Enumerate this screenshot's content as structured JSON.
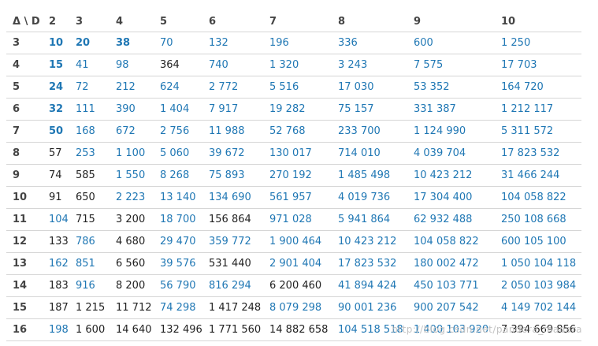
{
  "table": {
    "columns": [
      "Δ \\ D",
      "2",
      "3",
      "4",
      "5",
      "6",
      "7",
      "8",
      "9",
      "10"
    ],
    "rows": [
      {
        "label": "3",
        "cells": [
          {
            "v": "10",
            "s": "lb"
          },
          {
            "v": "20",
            "s": "lb"
          },
          {
            "v": "38",
            "s": "lb"
          },
          {
            "v": "70",
            "s": "l"
          },
          {
            "v": "132",
            "s": "l"
          },
          {
            "v": "196",
            "s": "l"
          },
          {
            "v": "336",
            "s": "l"
          },
          {
            "v": "600",
            "s": "l"
          },
          {
            "v": "1 250",
            "s": "l"
          }
        ]
      },
      {
        "label": "4",
        "cells": [
          {
            "v": "15",
            "s": "lb"
          },
          {
            "v": "41",
            "s": "l"
          },
          {
            "v": "98",
            "s": "l"
          },
          {
            "v": "364",
            "s": "p"
          },
          {
            "v": "740",
            "s": "l"
          },
          {
            "v": "1 320",
            "s": "l"
          },
          {
            "v": "3 243",
            "s": "l"
          },
          {
            "v": "7 575",
            "s": "l"
          },
          {
            "v": "17 703",
            "s": "l"
          }
        ]
      },
      {
        "label": "5",
        "cells": [
          {
            "v": "24",
            "s": "lb"
          },
          {
            "v": "72",
            "s": "l"
          },
          {
            "v": "212",
            "s": "l"
          },
          {
            "v": "624",
            "s": "l"
          },
          {
            "v": "2 772",
            "s": "l"
          },
          {
            "v": "5 516",
            "s": "l"
          },
          {
            "v": "17 030",
            "s": "l"
          },
          {
            "v": "53 352",
            "s": "l"
          },
          {
            "v": "164 720",
            "s": "l"
          }
        ]
      },
      {
        "label": "6",
        "cells": [
          {
            "v": "32",
            "s": "lb"
          },
          {
            "v": "111",
            "s": "l"
          },
          {
            "v": "390",
            "s": "l"
          },
          {
            "v": "1 404",
            "s": "l"
          },
          {
            "v": "7 917",
            "s": "l"
          },
          {
            "v": "19 282",
            "s": "l"
          },
          {
            "v": "75 157",
            "s": "l"
          },
          {
            "v": "331 387",
            "s": "l"
          },
          {
            "v": "1 212 117",
            "s": "l"
          }
        ]
      },
      {
        "label": "7",
        "cells": [
          {
            "v": "50",
            "s": "lb"
          },
          {
            "v": "168",
            "s": "l"
          },
          {
            "v": "672",
            "s": "l"
          },
          {
            "v": "2 756",
            "s": "l"
          },
          {
            "v": "11 988",
            "s": "l"
          },
          {
            "v": "52 768",
            "s": "l"
          },
          {
            "v": "233 700",
            "s": "l"
          },
          {
            "v": "1 124 990",
            "s": "l"
          },
          {
            "v": "5 311 572",
            "s": "l"
          }
        ]
      },
      {
        "label": "8",
        "cells": [
          {
            "v": "57",
            "s": "p"
          },
          {
            "v": "253",
            "s": "l"
          },
          {
            "v": "1 100",
            "s": "l"
          },
          {
            "v": "5 060",
            "s": "l"
          },
          {
            "v": "39 672",
            "s": "l"
          },
          {
            "v": "130 017",
            "s": "l"
          },
          {
            "v": "714 010",
            "s": "l"
          },
          {
            "v": "4 039 704",
            "s": "l"
          },
          {
            "v": "17 823 532",
            "s": "l"
          }
        ]
      },
      {
        "label": "9",
        "cells": [
          {
            "v": "74",
            "s": "p"
          },
          {
            "v": "585",
            "s": "p"
          },
          {
            "v": "1 550",
            "s": "l"
          },
          {
            "v": "8 268",
            "s": "l"
          },
          {
            "v": "75 893",
            "s": "l"
          },
          {
            "v": "270 192",
            "s": "l"
          },
          {
            "v": "1 485 498",
            "s": "l"
          },
          {
            "v": "10 423 212",
            "s": "l"
          },
          {
            "v": "31 466 244",
            "s": "l"
          }
        ]
      },
      {
        "label": "10",
        "cells": [
          {
            "v": "91",
            "s": "p"
          },
          {
            "v": "650",
            "s": "p"
          },
          {
            "v": "2 223",
            "s": "l"
          },
          {
            "v": "13 140",
            "s": "l"
          },
          {
            "v": "134 690",
            "s": "l"
          },
          {
            "v": "561 957",
            "s": "l"
          },
          {
            "v": "4 019 736",
            "s": "l"
          },
          {
            "v": "17 304 400",
            "s": "l"
          },
          {
            "v": "104 058 822",
            "s": "l"
          }
        ]
      },
      {
        "label": "11",
        "cells": [
          {
            "v": "104",
            "s": "l"
          },
          {
            "v": "715",
            "s": "p"
          },
          {
            "v": "3 200",
            "s": "p"
          },
          {
            "v": "18 700",
            "s": "l"
          },
          {
            "v": "156 864",
            "s": "p"
          },
          {
            "v": "971 028",
            "s": "l"
          },
          {
            "v": "5 941 864",
            "s": "l"
          },
          {
            "v": "62 932 488",
            "s": "l"
          },
          {
            "v": "250 108 668",
            "s": "l"
          }
        ]
      },
      {
        "label": "12",
        "cells": [
          {
            "v": "133",
            "s": "p"
          },
          {
            "v": "786",
            "s": "l"
          },
          {
            "v": "4 680",
            "s": "p"
          },
          {
            "v": "29 470",
            "s": "l"
          },
          {
            "v": "359 772",
            "s": "l"
          },
          {
            "v": "1 900 464",
            "s": "l"
          },
          {
            "v": "10 423 212",
            "s": "l"
          },
          {
            "v": "104 058 822",
            "s": "l"
          },
          {
            "v": "600 105 100",
            "s": "l"
          }
        ]
      },
      {
        "label": "13",
        "cells": [
          {
            "v": "162",
            "s": "l"
          },
          {
            "v": "851",
            "s": "l"
          },
          {
            "v": "6 560",
            "s": "p"
          },
          {
            "v": "39 576",
            "s": "l"
          },
          {
            "v": "531 440",
            "s": "p"
          },
          {
            "v": "2 901 404",
            "s": "l"
          },
          {
            "v": "17 823 532",
            "s": "l"
          },
          {
            "v": "180 002 472",
            "s": "l"
          },
          {
            "v": "1 050 104 118",
            "s": "l"
          }
        ]
      },
      {
        "label": "14",
        "cells": [
          {
            "v": "183",
            "s": "p"
          },
          {
            "v": "916",
            "s": "l"
          },
          {
            "v": "8 200",
            "s": "p"
          },
          {
            "v": "56 790",
            "s": "l"
          },
          {
            "v": "816 294",
            "s": "l"
          },
          {
            "v": "6 200 460",
            "s": "p"
          },
          {
            "v": "41 894 424",
            "s": "l"
          },
          {
            "v": "450 103 771",
            "s": "l"
          },
          {
            "v": "2 050 103 984",
            "s": "l"
          }
        ]
      },
      {
        "label": "15",
        "cells": [
          {
            "v": "187",
            "s": "p"
          },
          {
            "v": "1 215",
            "s": "p"
          },
          {
            "v": "11 712",
            "s": "p"
          },
          {
            "v": "74 298",
            "s": "l"
          },
          {
            "v": "1 417 248",
            "s": "p"
          },
          {
            "v": "8 079 298",
            "s": "l"
          },
          {
            "v": "90 001 236",
            "s": "l"
          },
          {
            "v": "900 207 542",
            "s": "l"
          },
          {
            "v": "4 149 702 144",
            "s": "l"
          }
        ]
      },
      {
        "label": "16",
        "cells": [
          {
            "v": "198",
            "s": "l"
          },
          {
            "v": "1 600",
            "s": "p"
          },
          {
            "v": "14 640",
            "s": "p"
          },
          {
            "v": "132 496",
            "s": "p"
          },
          {
            "v": "1 771 560",
            "s": "p"
          },
          {
            "v": "14 882 658",
            "s": "p"
          },
          {
            "v": "104 518 518",
            "s": "l"
          },
          {
            "v": "1 400 103 920",
            "s": "l"
          },
          {
            "v": "7 394 669 856",
            "s": "p"
          }
        ]
      }
    ]
  },
  "watermark": "http://blog.csdn.net/pandora_madara",
  "colors": {
    "link": "#1f77b4",
    "plain": "#222222",
    "header": "#444444",
    "rule": "#d6d6d6"
  }
}
